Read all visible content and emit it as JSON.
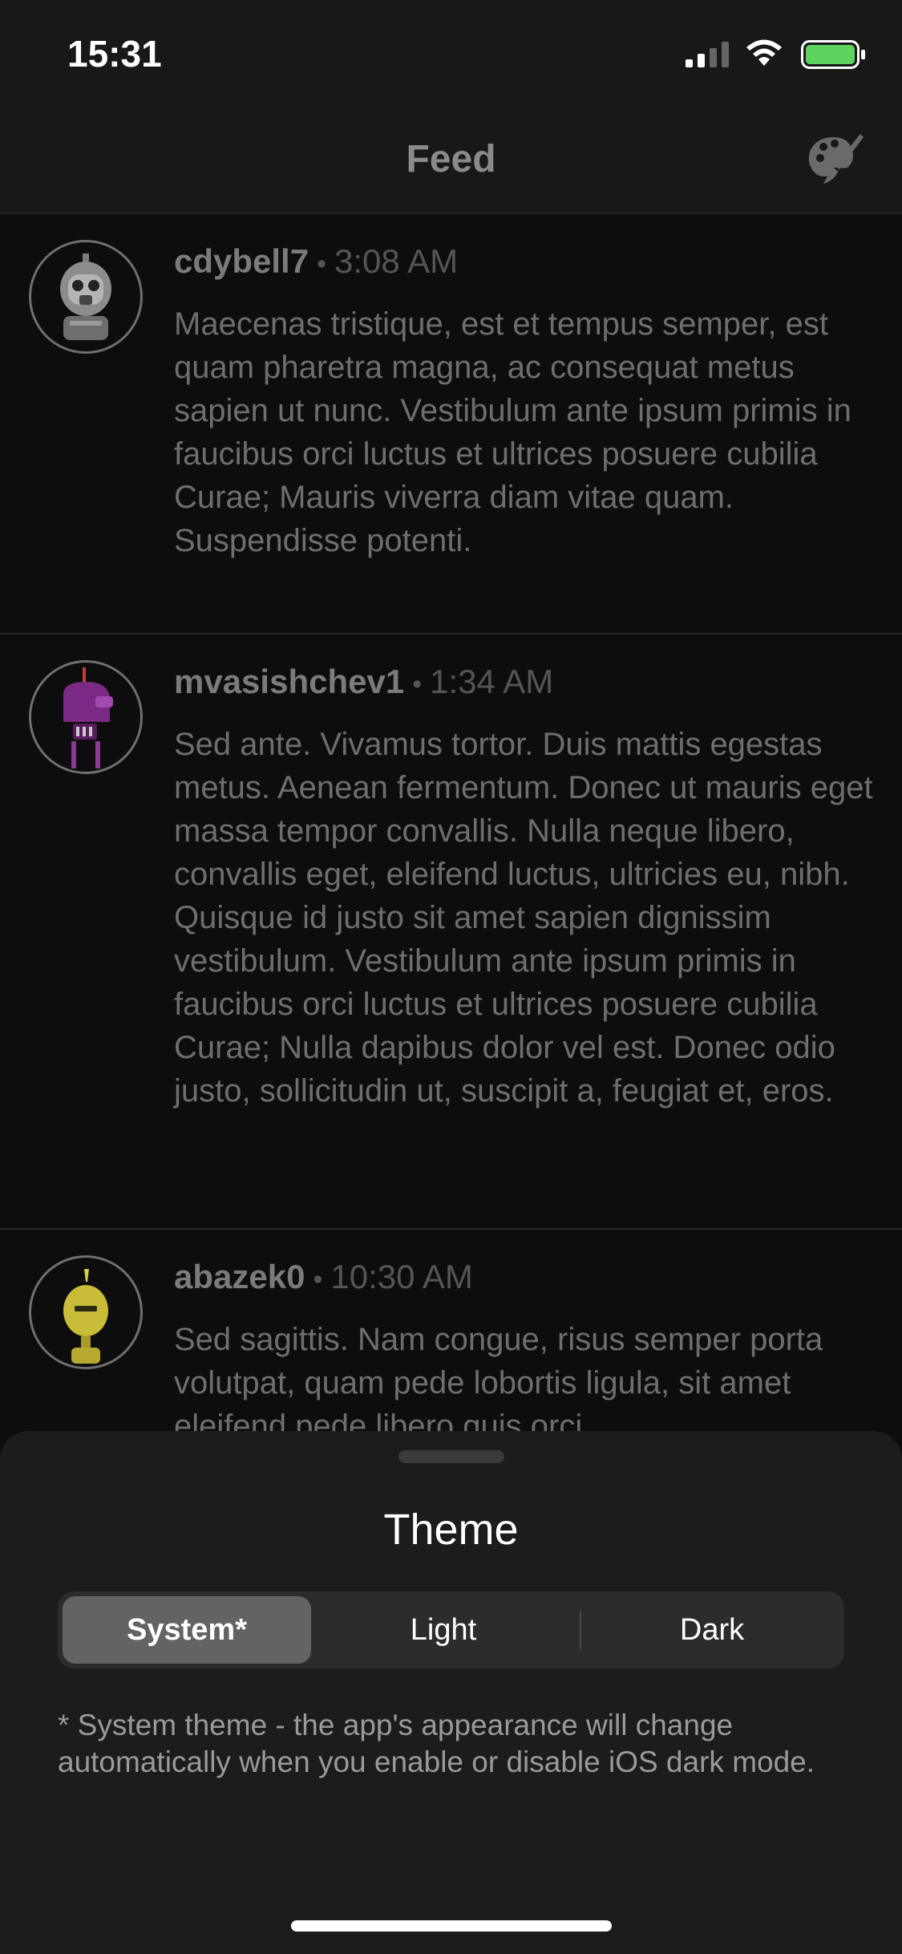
{
  "status_bar": {
    "time": "15:31",
    "icons": [
      "signal-icon",
      "wifi-icon",
      "battery-icon"
    ],
    "battery_color": "#5fd35f"
  },
  "nav": {
    "title": "Feed",
    "right_icon": "palette-icon"
  },
  "feed": {
    "posts": [
      {
        "username": "cdybell7",
        "separator": "•",
        "time": "3:08 AM",
        "avatar_icon": "robot-avatar-gray-icon",
        "body": "Maecenas tristique, est et tempus semper, est quam pharetra magna, ac consequat metus sapien ut nunc. Vestibulum ante ipsum primis in faucibus orci luctus et ultrices posuere cubilia Curae; Mauris viverra diam vitae quam. Suspendisse potenti."
      },
      {
        "username": "mvasishchev1",
        "separator": "•",
        "time": "1:34 AM",
        "avatar_icon": "robot-avatar-purple-icon",
        "body": "Sed ante. Vivamus tortor. Duis mattis egestas metus. Aenean fermentum. Donec ut mauris eget massa tempor convallis. Nulla neque libero, convallis eget, eleifend luctus, ultricies eu, nibh. Quisque id justo sit amet sapien dignissim vestibulum. Vestibulum ante ipsum primis in faucibus orci luctus et ultrices posuere cubilia Curae; Nulla dapibus dolor vel est. Donec odio justo, sollicitudin ut, suscipit a, feugiat et, eros."
      },
      {
        "username": "abazek0",
        "separator": "•",
        "time": "10:30 AM",
        "avatar_icon": "robot-avatar-yellow-icon",
        "body": "Sed sagittis. Nam congue, risus semper porta volutpat, quam pede lobortis ligula, sit amet eleifend pede libero quis orci."
      }
    ]
  },
  "theme_sheet": {
    "title": "Theme",
    "options": [
      {
        "label": "System*",
        "selected": true
      },
      {
        "label": "Light",
        "selected": false
      },
      {
        "label": "Dark",
        "selected": false
      }
    ],
    "footnote": "* System theme - the app's appearance will change automatically when you enable or disable iOS dark mode."
  }
}
